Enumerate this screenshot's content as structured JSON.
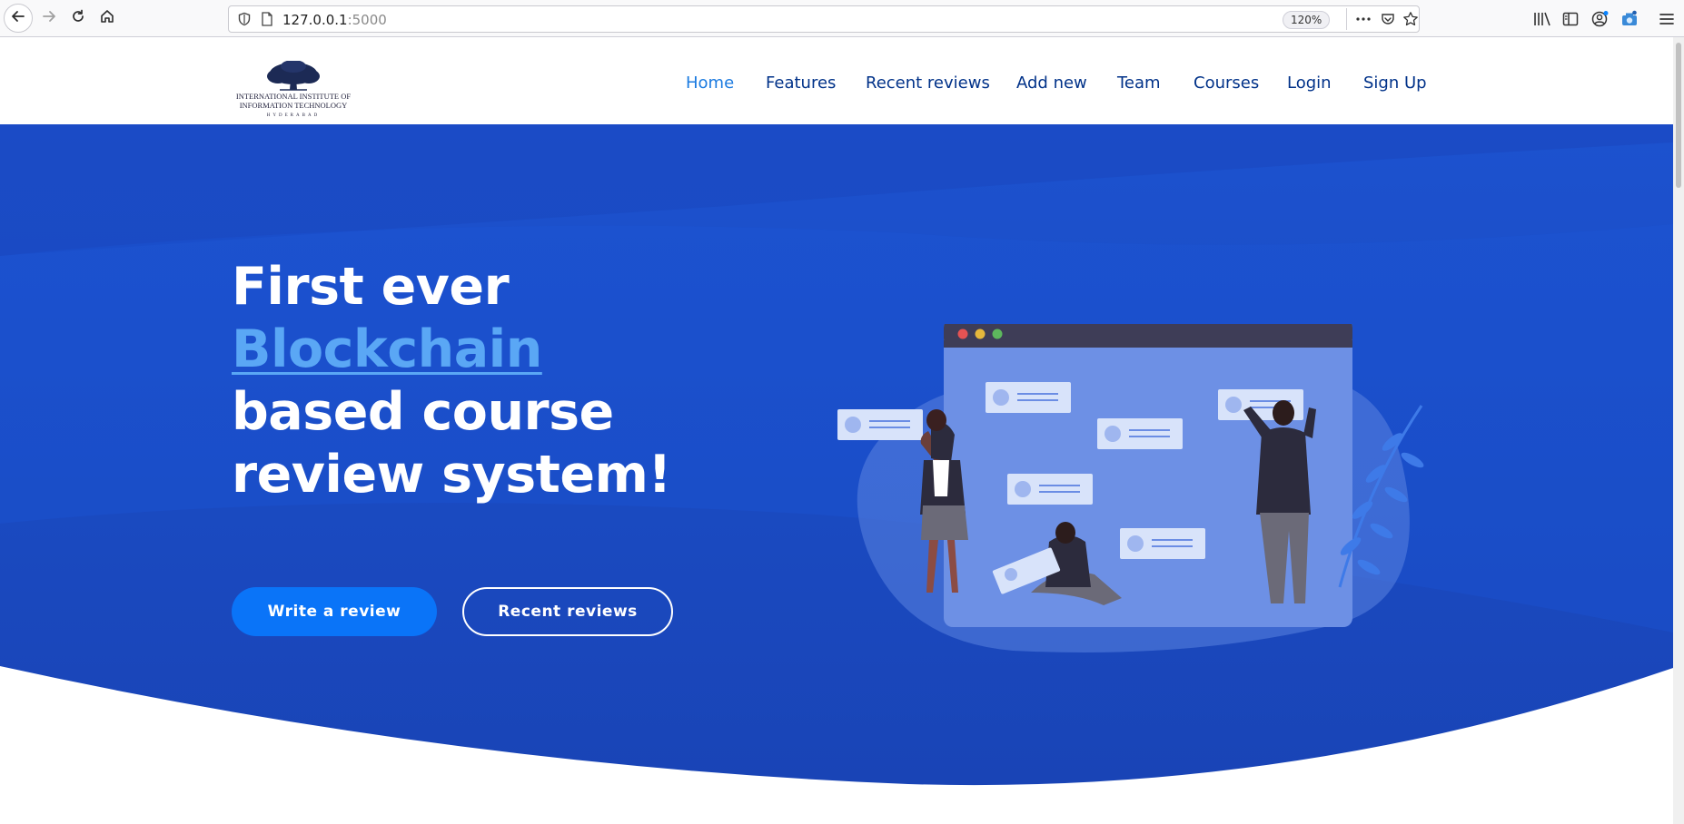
{
  "browser": {
    "url_host": "127.0.0.1",
    "url_port": ":5000",
    "zoom": "120%"
  },
  "header": {
    "logo": {
      "line1": "INTERNATIONAL INSTITUTE OF",
      "line2": "INFORMATION TECHNOLOGY",
      "line3": "HYDERABAD"
    },
    "nav": [
      {
        "label": "Home",
        "active": true
      },
      {
        "label": "Features"
      },
      {
        "label": "Recent reviews"
      },
      {
        "label": "Add new"
      },
      {
        "label": "Team"
      },
      {
        "label": "Courses"
      },
      {
        "label": "Login"
      },
      {
        "label": "Sign Up"
      }
    ]
  },
  "hero": {
    "title_line1": "First ever",
    "title_highlight": "Blockchain",
    "title_line3": "based course review system!",
    "primary_button": "Write a review",
    "secondary_button": "Recent reviews"
  },
  "colors": {
    "nav_text": "#013289",
    "nav_active": "#1a7ae0",
    "hero_bg": "#1a4bc2",
    "primary_button": "#0a74f8",
    "highlight_text": "#5aa7f5"
  }
}
